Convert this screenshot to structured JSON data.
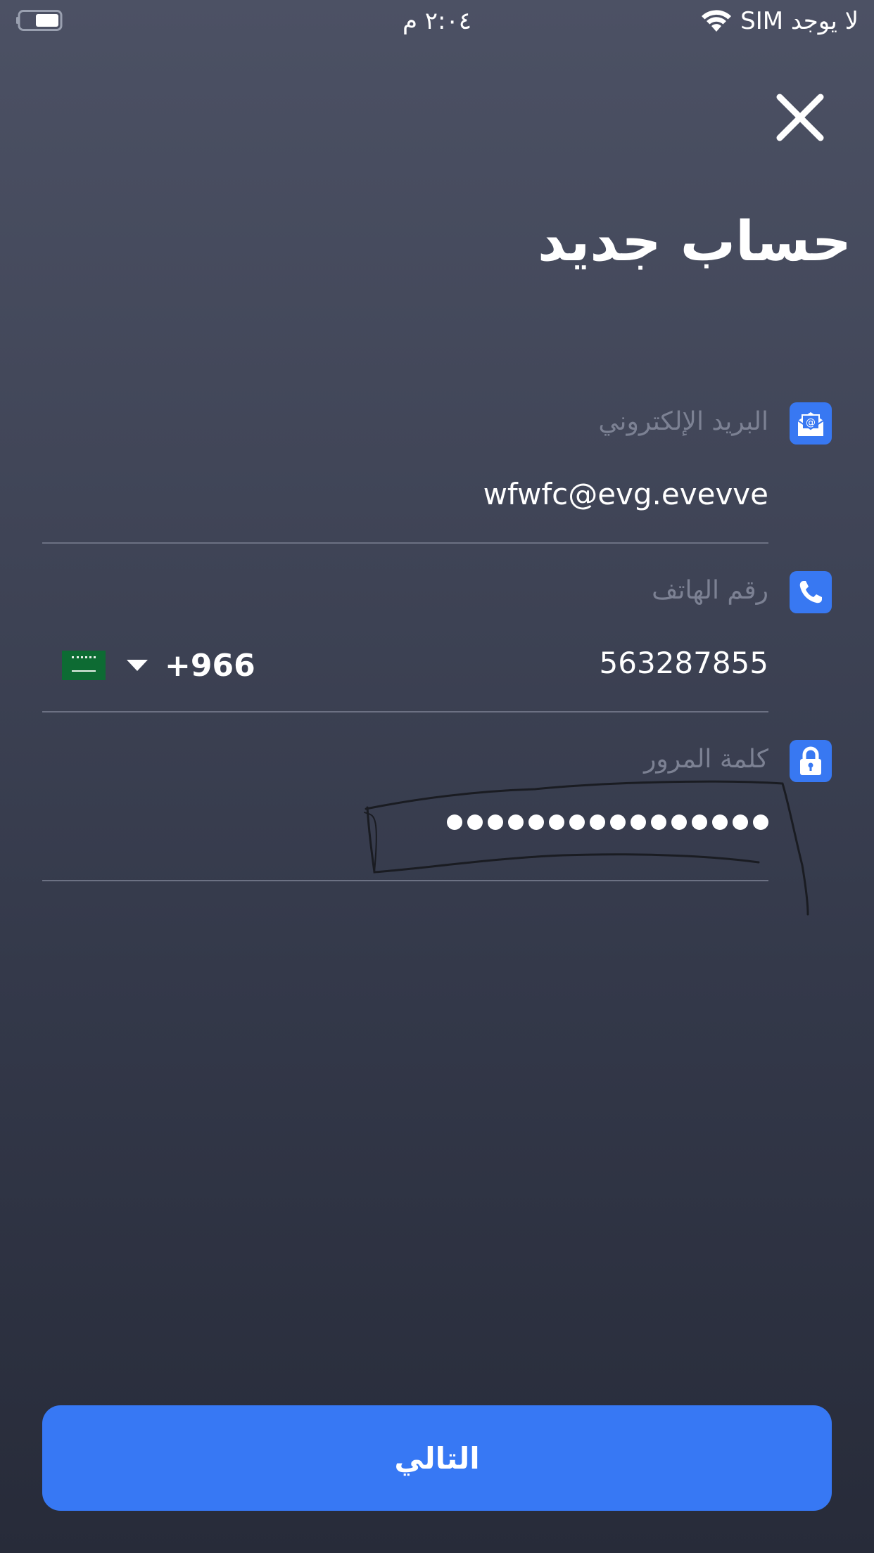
{
  "status_bar": {
    "carrier": "لا يوجد SIM",
    "time": "٢:٠٤ م",
    "wifi_icon": "wifi-icon",
    "battery_icon": "battery-icon"
  },
  "header": {
    "close_icon": "close-icon",
    "title": "حساب جديد"
  },
  "form": {
    "email": {
      "icon": "email-icon",
      "label": "البريد الإلكتروني",
      "value": "wfwfc@evg.evevve"
    },
    "phone": {
      "icon": "phone-icon",
      "label": "رقم الهاتف",
      "value": "563287855",
      "country_flag": "saudi-arabia-flag",
      "dial_code": "+966"
    },
    "password": {
      "icon": "lock-icon",
      "label": "كلمة المرور",
      "masked_length": 16
    }
  },
  "footer": {
    "next_label": "التالي"
  },
  "colors": {
    "accent": "#3778f4",
    "background_top": "#4c5164",
    "background_bottom": "#272b39",
    "label": "#7c8193",
    "divider": "#6c7183"
  }
}
